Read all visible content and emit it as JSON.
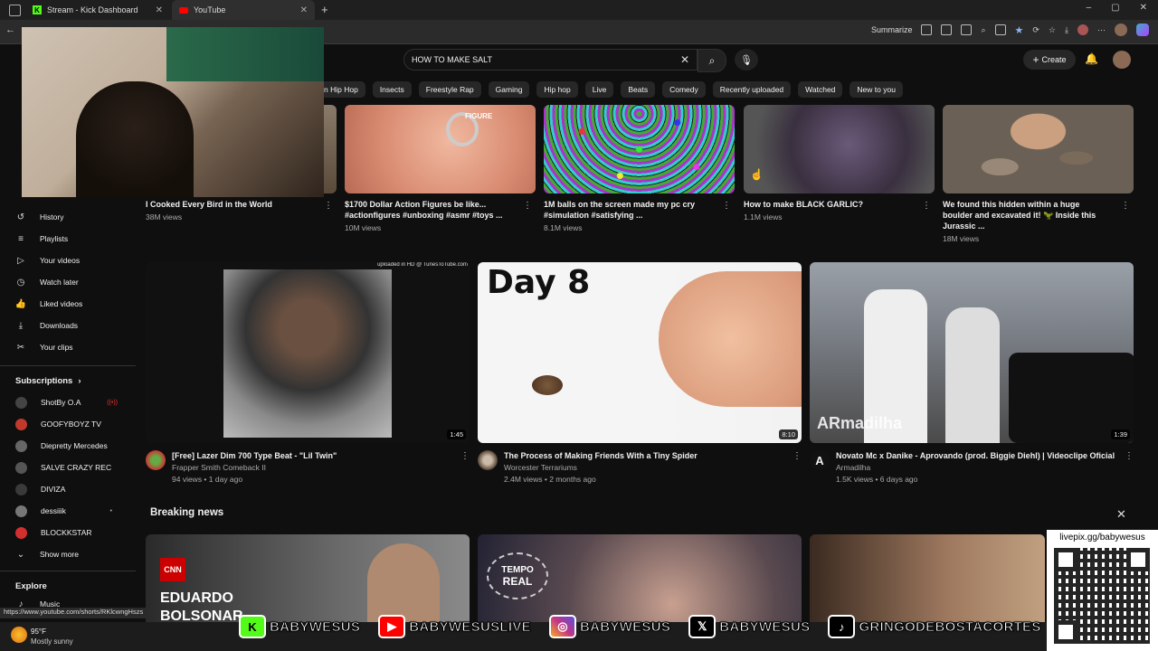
{
  "browser": {
    "tabs": [
      {
        "label": "Stream - Kick Dashboard"
      },
      {
        "label": "YouTube"
      }
    ],
    "summarize_label": "Summarize",
    "status_url": "https://www.youtube.com/shorts/RKlcwngHszs"
  },
  "header": {
    "search_value": "HOW TO MAKE SALT",
    "create_label": "Create"
  },
  "chips": [
    "n Hip Hop",
    "Insects",
    "Freestyle Rap",
    "Gaming",
    "Hip hop",
    "Live",
    "Beats",
    "Comedy",
    "Recently uploaded",
    "Watched",
    "New to you"
  ],
  "sidebar": {
    "you_items": [
      {
        "label": "History",
        "icon": "history-icon"
      },
      {
        "label": "Playlists",
        "icon": "playlists-icon"
      },
      {
        "label": "Your videos",
        "icon": "your-videos-icon"
      },
      {
        "label": "Watch later",
        "icon": "watch-later-icon"
      },
      {
        "label": "Liked videos",
        "icon": "like-icon"
      },
      {
        "label": "Downloads",
        "icon": "download-icon"
      },
      {
        "label": "Your clips",
        "icon": "clips-icon"
      }
    ],
    "subscriptions_label": "Subscriptions",
    "subscriptions": [
      {
        "label": "ShotBy O.A",
        "color": "#444444"
      },
      {
        "label": "GOOFYBOYZ TV",
        "color": "#c0392b"
      },
      {
        "label": "Diepretty Mercedes",
        "color": "#666666"
      },
      {
        "label": "SALVE CRAZY REC",
        "color": "#555555"
      },
      {
        "label": "DIVIZA",
        "color": "#3a3a3a"
      },
      {
        "label": "dessiiik",
        "color": "#777777"
      },
      {
        "label": "BLOCKKSTAR",
        "color": "#d32f2f"
      }
    ],
    "show_more_label": "Show more",
    "explore_label": "Explore",
    "music_label": "Music"
  },
  "row1": [
    {
      "title": "I Cooked Every Bird in the World",
      "meta": "38M views"
    },
    {
      "title": "$1700 Dollar Action Figures be like... #actionfigures #unboxing #asmr #toys ...",
      "meta": "10M views",
      "thumb_text": "FIGURE"
    },
    {
      "title": "1M balls on the screen made my pc cry #simulation #satisfying ...",
      "meta": "8.1M views"
    },
    {
      "title": "How to make BLACK GARLIC?",
      "meta": "1.1M views"
    },
    {
      "title": "We found this hidden within a huge boulder and excavated it! 🦖 Inside this Jurassic ...",
      "meta": "18M views"
    }
  ],
  "row2": [
    {
      "title": "[Free] Lazer Dim 700 Type Beat - \"Lil Twin\"",
      "channel": "Frapper Smith Comeback II",
      "meta": "94 views • 1 day ago",
      "duration": "1:45",
      "thumb_text": "uploaded in HD @ TunesToTube.com"
    },
    {
      "title": "The Process of Making Friends With a Tiny Spider",
      "channel": "Worcester Terrariums",
      "meta": "2.4M views • 2 months ago",
      "duration": "8:10",
      "thumb_text": "Day 8"
    },
    {
      "title": "Novato Mc x Danike - Aprovando (prod. Biggie Diehl) | Videoclipe Oficial",
      "channel": "Armadilha",
      "meta": "1.5K views • 6 days ago",
      "duration": "1:39",
      "thumb_text": "ARmadilha",
      "avatar_letter": "A"
    }
  ],
  "breaking_news": {
    "title": "Breaking news",
    "thumbs": [
      {
        "logo": "CNN",
        "text1": "EDUARDO",
        "text2": "BOLSONAR"
      },
      {
        "text1": "TEMPO",
        "text2": "REAL"
      },
      {}
    ]
  },
  "overlay": {
    "qr_label": "livepix.gg/babywesus",
    "socials": [
      {
        "icon": "kick-icon",
        "label": "BABYWESUS",
        "color": "#53fc18"
      },
      {
        "icon": "youtube-icon",
        "label": "BABYWESUSLIVE",
        "color": "#ff0000"
      },
      {
        "icon": "instagram-icon",
        "label": "BABYWESUS",
        "color": "#c13584"
      },
      {
        "icon": "x-icon",
        "label": "BABYWESUS",
        "color": "#000000"
      },
      {
        "icon": "tiktok-icon",
        "label": "GRINGODEBOSTACORTES",
        "color": "#000000"
      }
    ]
  },
  "weather": {
    "temp": "95°F",
    "desc": "Mostly sunny"
  }
}
